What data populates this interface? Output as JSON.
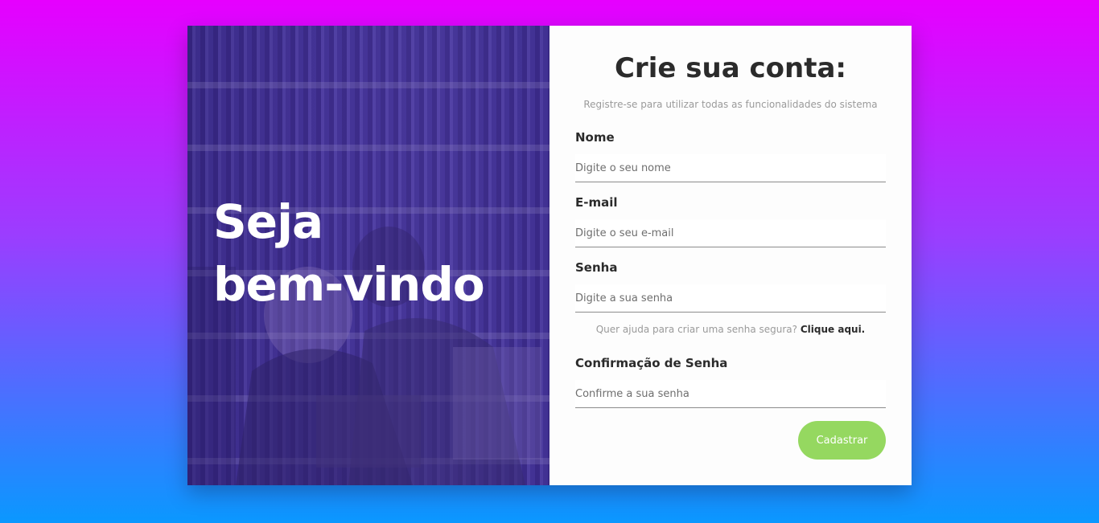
{
  "hero": {
    "line1": "Seja",
    "line2": "bem-vindo"
  },
  "form": {
    "title": "Crie sua conta:",
    "subtitle": "Registre-se para utilizar todas as funcionalidades do sistema",
    "fields": [
      {
        "label": "Nome",
        "placeholder": "Digite o seu nome",
        "value": ""
      },
      {
        "label": "E-mail",
        "placeholder": "Digite o seu e-mail",
        "value": ""
      },
      {
        "label": "Senha",
        "placeholder": "Digite a sua senha",
        "value": ""
      },
      {
        "label": "Confirmação de Senha",
        "placeholder": "Confirme a sua senha",
        "value": ""
      }
    ],
    "help_text": "Quer ajuda para criar uma senha segura?",
    "help_link": "Clique aqui.",
    "submit_label": "Cadastrar"
  },
  "colors": {
    "background_top": "#e600ff",
    "background_bottom": "#0a98ff",
    "hero_tint": "#3c2896",
    "accent_button": "#95d860",
    "text_dark": "#2b2b2b",
    "text_muted": "#9a9a9a"
  }
}
